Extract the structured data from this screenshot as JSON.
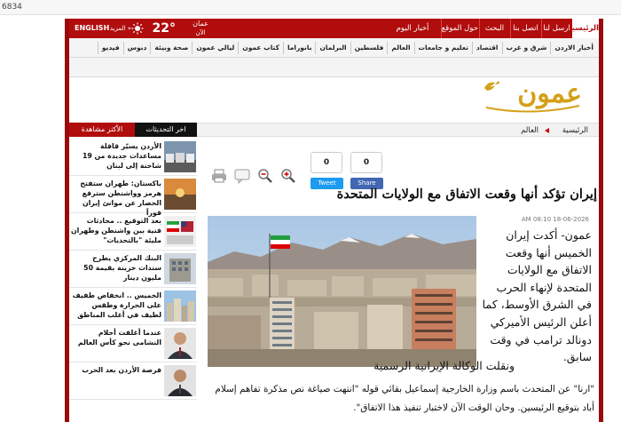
{
  "browser": {
    "url_fragment": "6834"
  },
  "topbar": {
    "home": "الرئيسية",
    "send": "ارسل لنا",
    "contact": "اتصل بنا",
    "search": "البحث",
    "about": "حول الموقع",
    "today_news": "أخبار اليوم",
    "weather_city": "عمان",
    "weather_now": "الآن",
    "temperature": "22°",
    "more": "« المزيد",
    "english": "ENGLISH"
  },
  "nav": {
    "items": [
      "أخبار الاردن",
      "شرق و غرب",
      "اقتصاد",
      "تعليم و جامعات",
      "العالم",
      "فلسطين",
      "البرلمان",
      "بانوراما",
      "كتاب عمون",
      "ليالي عمون",
      "صحة وبيئة",
      "دبوس",
      "فيديو"
    ]
  },
  "logo": {
    "text": "عمون"
  },
  "breadcrumb": {
    "home": "الرئيسية",
    "section": "العالم"
  },
  "sidebar": {
    "tab_latest": "اخر التحديثات",
    "tab_most_viewed": "الأكثر مشاهدة",
    "items": [
      {
        "title": "الأردن يسيّر قافلة مساعدات جديدة من 19 شاحنة إلى لبنان",
        "thumb": "trucks"
      },
      {
        "title": "باكستان: طهران ستفتح هرمز وواشنطن سترفع الحصار عن موانئ إيران فوراً",
        "thumb": "sunset"
      },
      {
        "title": "بعد التوقيع .. محادثات فنية بين واشنطن وطهران مليئة \"بالتحديات\"",
        "thumb": "flags"
      },
      {
        "title": "البنك المركزي يطرح سندات خزينة بقيمة 50 مليون دينار",
        "thumb": "building"
      },
      {
        "title": "الخميس .. انخفاض طفيف على الحرارة وطقس لطيف في أغلب المناطق",
        "thumb": "city"
      },
      {
        "title": "عندما أغلقت أحلام النشامى نحو كأس العالم",
        "thumb": "person1"
      },
      {
        "title": "فرصة الأردن بعد الحرب",
        "thumb": "person2"
      }
    ]
  },
  "share": {
    "tweet_count": "0",
    "share_count": "0",
    "tweet_label": "Tweet",
    "share_label": "Share"
  },
  "article": {
    "title": "إيران تؤكد أنها وقعت الاتفاق مع الولايات المتحدة",
    "date": "18-06-2026 08:10 AM",
    "lead": "عمون- أكدت إيران الخميس أنها وقعت الاتفاق مع الولايات المتحدة لإنهاء الحرب في الشرق الأوسط، كما أعلن الرئيس الأميركي دونالد ترامب في وقت سابق.",
    "para2": "ونقلت الوكالة الإيرانية الرسمية",
    "para3": "\"ارنا\" عن المتحدث باسم وزارة الخارجية إسماعيل بقائي قوله \"انتهت صياغة نص مذكرة تفاهم إسلام أباد بتوقيع الرئيسين. وحان الوقت الآن لاختبار تنفيذ هذا الاتفاق\"."
  },
  "colors": {
    "brand_red": "#b10d0d",
    "tweet_blue": "#1d9bf0",
    "facebook_blue": "#4267b2"
  }
}
